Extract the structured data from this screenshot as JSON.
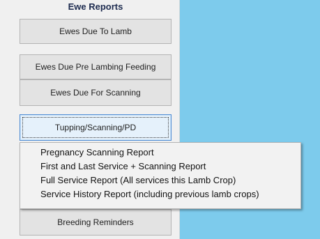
{
  "panel": {
    "group_title": "Ewe Reports",
    "buttons": {
      "ewes_due_to_lamb": "Ewes Due To Lamb",
      "ewes_due_pre_lambing_feeding": "Ewes Due Pre Lambing Feeding",
      "ewes_due_for_scanning": "Ewes Due For Scanning",
      "tupping_scanning_pd": "Tupping/Scanning/PD",
      "breeding_reminders": "Breeding Reminders"
    }
  },
  "dropdown_menu": {
    "items": [
      "Pregnancy Scanning Report",
      "First and Last Service  + Scanning Report",
      "Full Service Report (All services this Lamb Crop)",
      "Service History Report (including previous lamb crops)"
    ]
  },
  "colors": {
    "panel_background": "#f0f0f0",
    "right_area_background": "#7dcbec",
    "focused_button_border": "#4d8bd4"
  }
}
